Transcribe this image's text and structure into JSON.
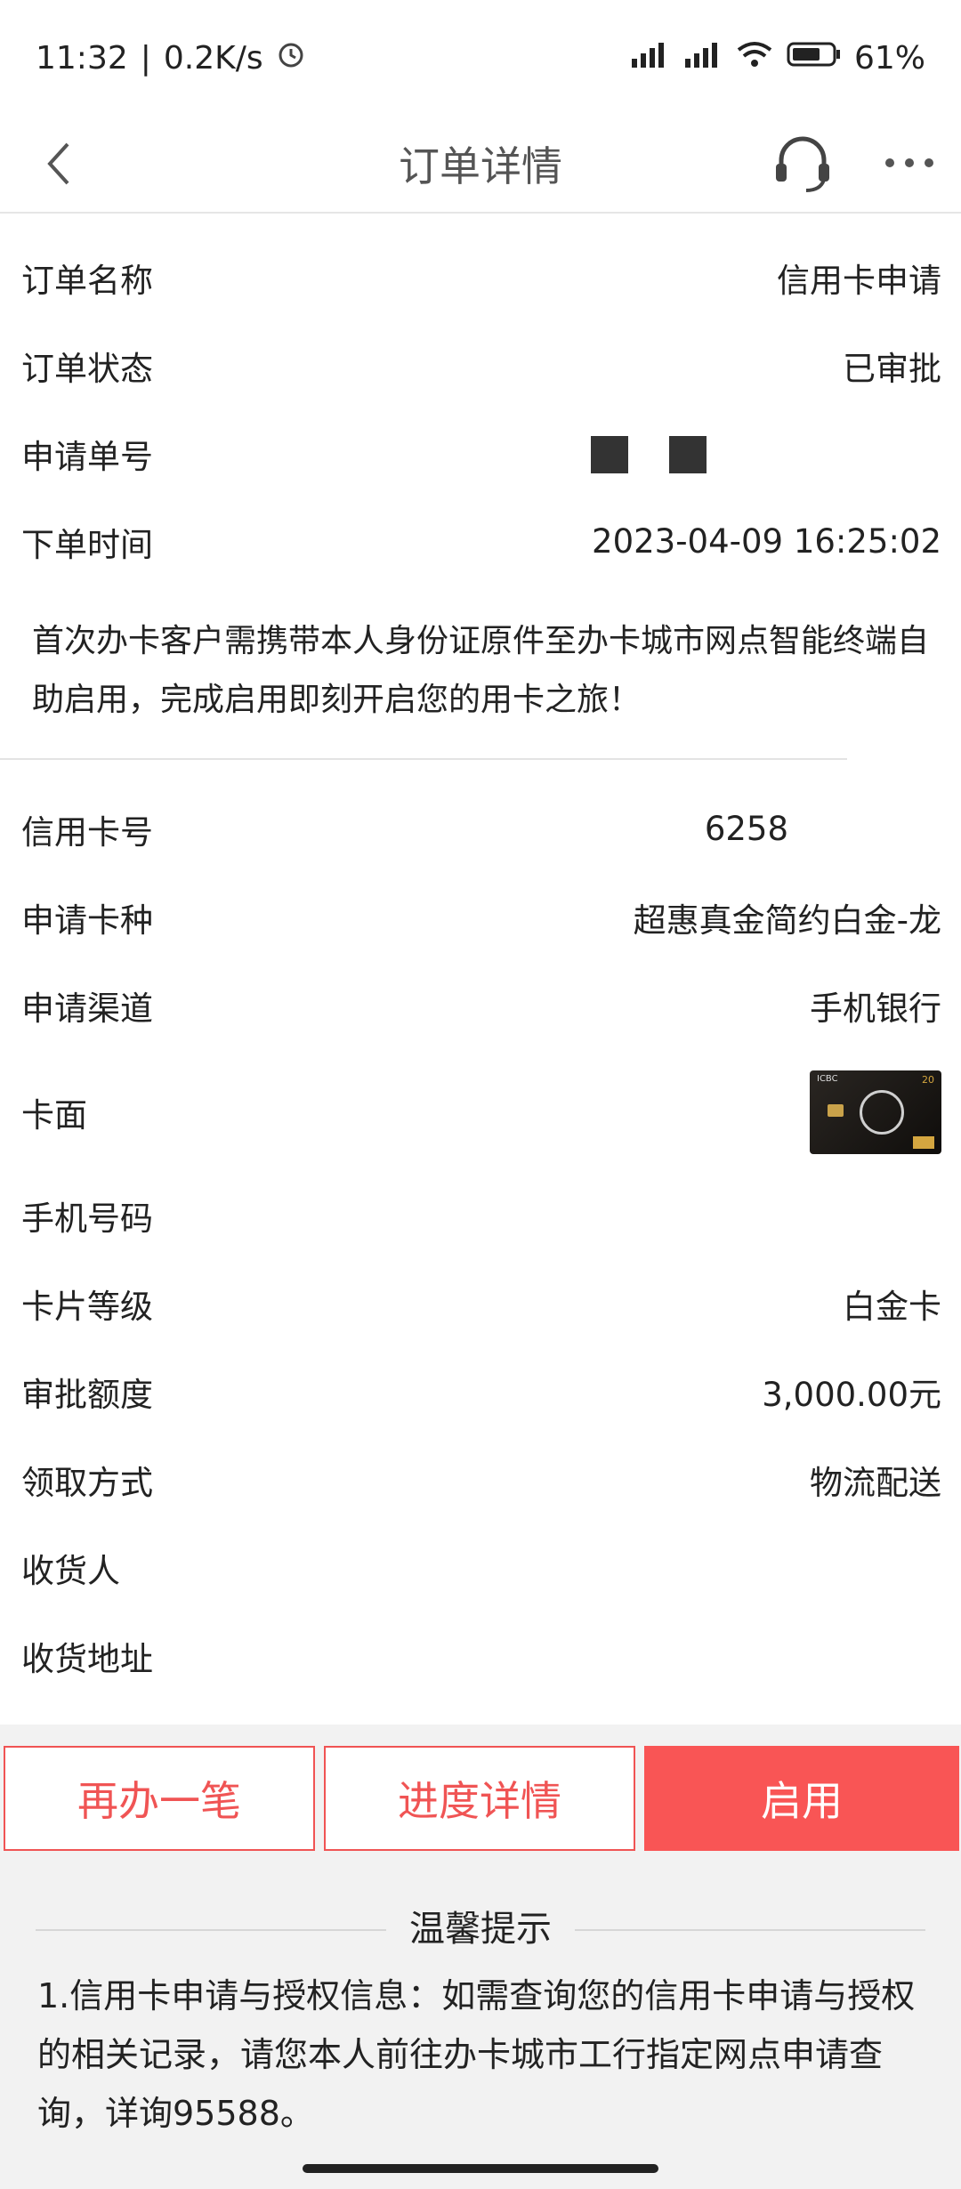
{
  "status_bar": {
    "time": "11:32",
    "speed": "0.2K/s",
    "battery": "61%"
  },
  "nav": {
    "title": "订单详情"
  },
  "order": [
    {
      "label": "订单名称",
      "value": "信用卡申请"
    },
    {
      "label": "订单状态",
      "value": "已审批"
    },
    {
      "label": "申请单号",
      "value": ""
    },
    {
      "label": "下单时间",
      "value": "2023-04-09 16:25:02"
    }
  ],
  "notice": "首次办卡客户需携带本人身份证原件至办卡城市网点智能终端自助启用，完成启用即刻开启您的用卡之旅！",
  "card": [
    {
      "label": "信用卡号",
      "value": "6258"
    },
    {
      "label": "申请卡种",
      "value": "超惠真金简约白金-龙"
    },
    {
      "label": "申请渠道",
      "value": "手机银行"
    },
    {
      "label": "卡面",
      "value": ""
    },
    {
      "label": "手机号码",
      "value": ""
    },
    {
      "label": "卡片等级",
      "value": "白金卡"
    },
    {
      "label": "审批额度",
      "value": "3,000.00元"
    },
    {
      "label": "领取方式",
      "value": "物流配送"
    },
    {
      "label": "收货人",
      "value": ""
    },
    {
      "label": "收货地址",
      "value": ""
    }
  ],
  "card_face": {
    "bank_text": "ICBC",
    "number_badge": "20"
  },
  "buttons": {
    "apply_again": "再办一笔",
    "progress": "进度详情",
    "activate": "启用"
  },
  "tips": {
    "title": "温馨提示",
    "text": "1.信用卡申请与授权信息：如需查询您的信用卡申请与授权的相关记录，请您本人前往办卡城市工行指定网点申请查询，详询95588。"
  },
  "colors": {
    "accent": "#f95555",
    "text": "#222222",
    "gray_bg": "#f2f2f2"
  }
}
